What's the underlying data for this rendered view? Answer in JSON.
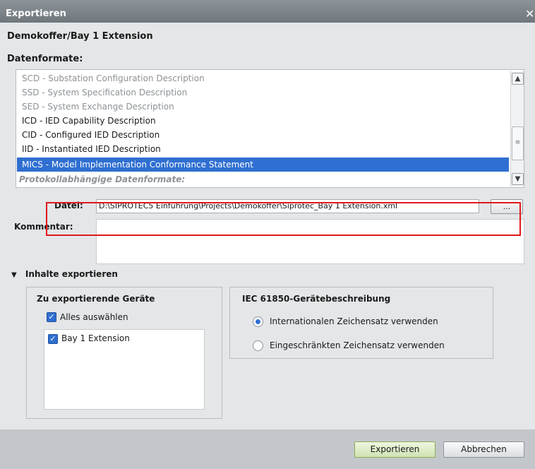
{
  "window": {
    "title": "Exportieren",
    "close_glyph": "✕"
  },
  "object_title": "Demokoffer/Bay 1 Extension",
  "formats": {
    "label": "Datenformate:",
    "items": [
      {
        "label": "SCD - Substation Configuration Description",
        "state": "disabled"
      },
      {
        "label": "SSD - System Specification Description",
        "state": "disabled"
      },
      {
        "label": "SED - System Exchange Description",
        "state": "disabled"
      },
      {
        "label": "ICD - IED Capability Description",
        "state": "enabled"
      },
      {
        "label": "CID - Configured IED Description",
        "state": "enabled"
      },
      {
        "label": "IID - Instantiated IED Description",
        "state": "enabled"
      },
      {
        "label": "MICS - Model Implementation Conformance Statement",
        "state": "selected"
      }
    ],
    "group_label": "Protokollabhängige Datenformate:"
  },
  "file": {
    "label": "Datei:",
    "value": "D:\\SIPROTEC5 Einführung\\Projects\\Demokoffer\\Siprotec_Bay 1 Extension.xml",
    "browse_label": "..."
  },
  "comment": {
    "label": "Kommentar:",
    "value": ""
  },
  "contents": {
    "expander_label": "Inhalte exportieren",
    "devices": {
      "title": "Zu exportierende Geräte",
      "select_all_label": "Alles auswählen",
      "select_all_checked": true,
      "items": [
        {
          "label": "Bay 1 Extension",
          "checked": true
        }
      ]
    },
    "iec": {
      "title": "IEC 61850-Gerätebeschreibung",
      "options": [
        {
          "label": "Internationalen Zeichensatz verwenden",
          "selected": true
        },
        {
          "label": "Eingeschränkten Zeichensatz verwenden",
          "selected": false
        }
      ]
    }
  },
  "buttons": {
    "export": "Exportieren",
    "cancel": "Abbrechen"
  },
  "colors": {
    "selection": "#2f6fd1",
    "export_button": "#cfe2b2",
    "highlight_box": "#e0191b",
    "titlebar": "#7d8489"
  },
  "icons": {
    "scroll_up": "chevron-up-icon",
    "scroll_down": "chevron-down-icon",
    "expander": "triangle-down-icon"
  }
}
